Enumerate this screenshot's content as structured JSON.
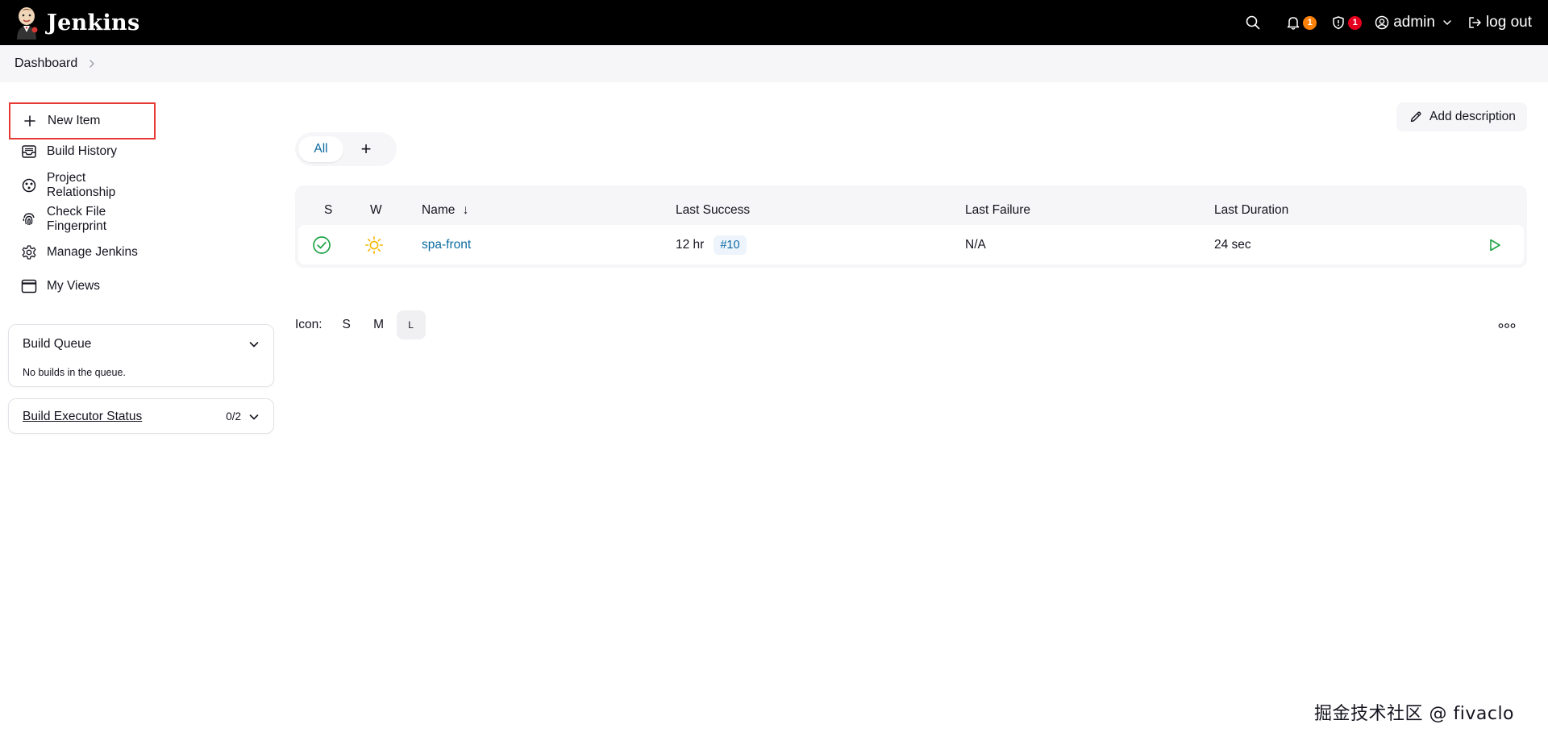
{
  "header": {
    "app_name": "Jenkins",
    "notifications_count": "1",
    "security_count": "1",
    "user": "admin",
    "logout": "log out"
  },
  "breadcrumb": {
    "item": "Dashboard"
  },
  "sidebar": {
    "tasks": [
      {
        "label": "New Item",
        "icon": "plus-icon"
      },
      {
        "label": "Build History",
        "icon": "inbox-icon"
      },
      {
        "label": "Project Relationship",
        "icon": "relationship-icon"
      },
      {
        "label": "Check File Fingerprint",
        "icon": "fingerprint-icon"
      },
      {
        "label": "Manage Jenkins",
        "icon": "gear-icon"
      },
      {
        "label": "My Views",
        "icon": "window-icon"
      }
    ],
    "build_queue": {
      "title": "Build Queue",
      "message": "No builds in the queue."
    },
    "executor_status": {
      "title": "Build Executor Status",
      "count": "0/2"
    }
  },
  "main": {
    "add_description": "Add description",
    "tabs": {
      "all": "All",
      "add": "+"
    },
    "table": {
      "headers": {
        "s": "S",
        "w": "W",
        "name": "Name",
        "sort_arrow": "↓",
        "last_success": "Last Success",
        "last_failure": "Last Failure",
        "last_duration": "Last Duration"
      },
      "rows": [
        {
          "status": "success",
          "weather": "sunny",
          "name": "spa-front",
          "last_success": "12 hr",
          "last_success_build": "#10",
          "last_failure": "N/A",
          "last_duration": "24 sec"
        }
      ]
    },
    "icon_size": {
      "label": "Icon:",
      "options": [
        "S",
        "M",
        "L"
      ],
      "selected": "L"
    }
  },
  "footer": {
    "watermark": "掘金技术社区 @ fivaclo"
  },
  "colors": {
    "header_bg": "#000000",
    "link": "#0b6aa2",
    "success_green": "#1ea446",
    "sun_yellow": "#f5b800",
    "highlight_red": "#e53935",
    "badge_orange": "#fe820a",
    "badge_red": "#e6001f"
  }
}
